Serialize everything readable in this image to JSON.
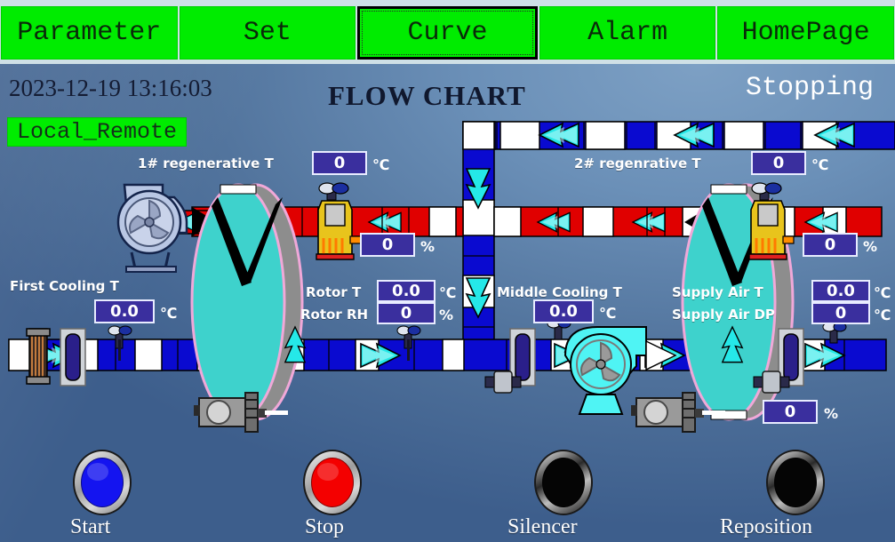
{
  "nav": {
    "items": [
      {
        "label": "Parameter",
        "selected": false
      },
      {
        "label": "Set",
        "selected": false
      },
      {
        "label": "Curve",
        "selected": true
      },
      {
        "label": "Alarm",
        "selected": false
      },
      {
        "label": "HomePage",
        "selected": false
      }
    ]
  },
  "header": {
    "datetime": "2023-12-19 13:16:03",
    "title": "FLOW CHART",
    "status": "Stopping",
    "mode_button": "Local_Remote"
  },
  "readouts": {
    "regen1": {
      "label": "1# regenerative T",
      "value": "0",
      "unit": "℃"
    },
    "regen2": {
      "label": "2# regenrative T",
      "value": "0",
      "unit": "℃"
    },
    "valve1_pct": {
      "value": "0",
      "unit": "%"
    },
    "valve2_pct": {
      "value": "0",
      "unit": "%"
    },
    "first_cooling": {
      "label": "First Cooling T",
      "value": "0.0",
      "unit": "℃"
    },
    "rotor_t": {
      "label": "Rotor T",
      "value": "0.0",
      "unit": "℃"
    },
    "rotor_rh": {
      "label": "Rotor RH",
      "value": "0",
      "unit": "%"
    },
    "middle_cooling": {
      "label": "Middle Cooling T",
      "value": "0.0",
      "unit": "℃"
    },
    "supply_air_t": {
      "label": "Supply Air T",
      "value": "0.0",
      "unit": "℃"
    },
    "supply_air_dp": {
      "label": "Supply Air DP",
      "value": "0",
      "unit": "℃"
    },
    "damper_pct": {
      "value": "0",
      "unit": "%"
    }
  },
  "buttons": [
    {
      "label": "Start",
      "color": "#1414f0",
      "kind": "lit"
    },
    {
      "label": "Stop",
      "color": "#f40000",
      "kind": "lit"
    },
    {
      "label": "Silencer",
      "color": "#050505",
      "kind": "dark"
    },
    {
      "label": "Reposition",
      "color": "#050505",
      "kind": "dark"
    }
  ],
  "colors": {
    "nav_green": "#00ec00",
    "value_box": "#3a2f9e",
    "duct_blue": "#0a0ad0",
    "duct_red": "#e00000",
    "rotor_teal": "#3ed2cc",
    "rotor_pink": "#f0a8d8",
    "arrow_cyan": "#25e8e8"
  }
}
